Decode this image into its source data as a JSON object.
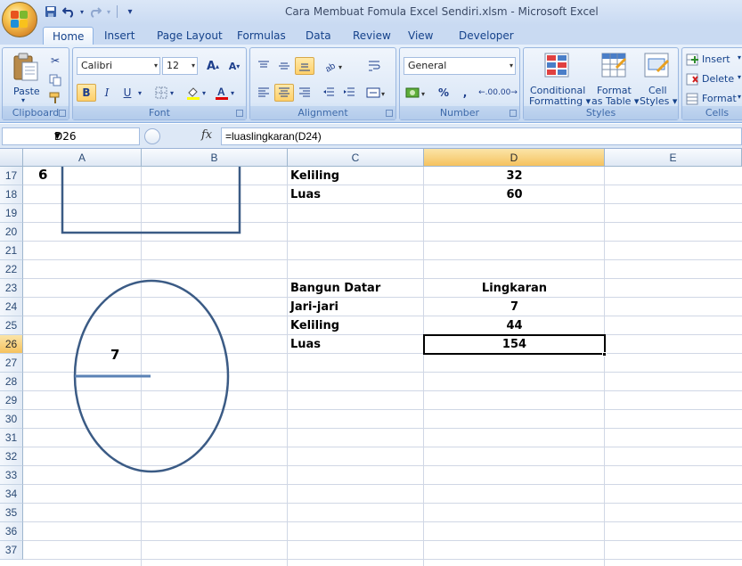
{
  "window": {
    "title": "Cara Membuat Fomula Excel Sendiri.xlsm - Microsoft Excel"
  },
  "quick_access": {
    "save_icon": "save-icon",
    "undo_icon": "undo-icon",
    "redo_icon": "redo-icon",
    "customize": "▾"
  },
  "tabs": [
    "Home",
    "Insert",
    "Page Layout",
    "Formulas",
    "Data",
    "Review",
    "View",
    "Developer"
  ],
  "ribbon": {
    "clipboard": {
      "label": "Clipboard",
      "paste": "Paste"
    },
    "font": {
      "label": "Font",
      "name": "Calibri",
      "size": "12",
      "bold": "B",
      "italic": "I",
      "underline": "U"
    },
    "alignment": {
      "label": "Alignment"
    },
    "number": {
      "label": "Number",
      "format": "General",
      "percent": "%",
      "comma": ",",
      "inc_decimal": ".00",
      "dec_decimal": ".00"
    },
    "styles": {
      "label": "Styles",
      "conditional": "Conditional",
      "conditional2": "Formatting",
      "format_table": "Format",
      "format_table2": "as Table",
      "cell_styles": "Cell",
      "cell_styles2": "Styles"
    },
    "cells": {
      "label": "Cells",
      "insert": "Insert",
      "delete": "Delete",
      "format": "Format"
    }
  },
  "formula_bar": {
    "name_box": "D26",
    "fx": "fx",
    "formula": "=luaslingkaran(D24)"
  },
  "columns": [
    "A",
    "B",
    "C",
    "D",
    "E"
  ],
  "selected_column": "D",
  "rows": [
    "17",
    "18",
    "19",
    "20",
    "21",
    "22",
    "23",
    "24",
    "25",
    "26",
    "27",
    "28",
    "29",
    "30",
    "31",
    "32",
    "33",
    "34",
    "35",
    "36",
    "37"
  ],
  "selected_row": "26",
  "cells": {
    "a17": "6",
    "c17": "Keliling",
    "d17": "32",
    "c18": "Luas",
    "d18": "60",
    "c23": "Bangun Datar",
    "d23": "Lingkaran",
    "c24": "Jari-jari",
    "d24": "7",
    "c25": "Keliling",
    "d25": "44",
    "c26": "Luas",
    "d26": "154"
  },
  "circle_label": "7",
  "colors": {
    "shape_stroke": "#3b5b85",
    "selection_header": "#f5c25f",
    "ribbon_bg": "#d6e4f6"
  }
}
